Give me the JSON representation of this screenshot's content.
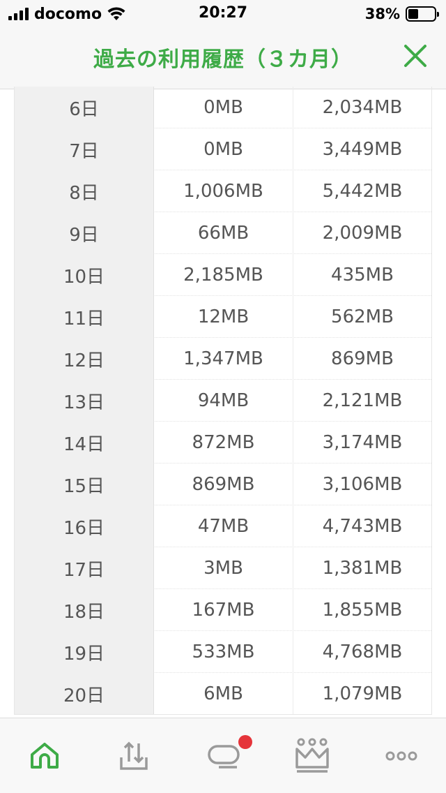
{
  "status_bar": {
    "carrier": "docomo",
    "time": "20:27",
    "battery_percent": "38%",
    "battery_level": 0.38
  },
  "header": {
    "title": "過去の利用履歴（３カ月）",
    "close_icon": "close-icon"
  },
  "usage_table": {
    "rows": [
      {
        "day": "6日",
        "col1": "0MB",
        "col2": "2,034MB"
      },
      {
        "day": "7日",
        "col1": "0MB",
        "col2": "3,449MB"
      },
      {
        "day": "8日",
        "col1": "1,006MB",
        "col2": "5,442MB"
      },
      {
        "day": "9日",
        "col1": "66MB",
        "col2": "2,009MB"
      },
      {
        "day": "10日",
        "col1": "2,185MB",
        "col2": "435MB"
      },
      {
        "day": "11日",
        "col1": "12MB",
        "col2": "562MB"
      },
      {
        "day": "12日",
        "col1": "1,347MB",
        "col2": "869MB"
      },
      {
        "day": "13日",
        "col1": "94MB",
        "col2": "2,121MB"
      },
      {
        "day": "14日",
        "col1": "872MB",
        "col2": "3,174MB"
      },
      {
        "day": "15日",
        "col1": "869MB",
        "col2": "3,106MB"
      },
      {
        "day": "16日",
        "col1": "47MB",
        "col2": "4,743MB"
      },
      {
        "day": "17日",
        "col1": "3MB",
        "col2": "1,381MB"
      },
      {
        "day": "18日",
        "col1": "167MB",
        "col2": "1,855MB"
      },
      {
        "day": "19日",
        "col1": "533MB",
        "col2": "4,768MB"
      },
      {
        "day": "20日",
        "col1": "6MB",
        "col2": "1,079MB"
      }
    ]
  },
  "tab_bar": {
    "tabs": [
      {
        "icon": "home-icon",
        "active": true
      },
      {
        "icon": "upload-tray-icon",
        "active": false
      },
      {
        "icon": "chat-icon",
        "active": false,
        "badge": true
      },
      {
        "icon": "crown-icon",
        "active": false
      },
      {
        "icon": "more-icon",
        "active": false
      }
    ]
  },
  "colors": {
    "accent": "#3eab47",
    "badge": "#e5343a",
    "icon_gray": "#9a9a9a"
  }
}
